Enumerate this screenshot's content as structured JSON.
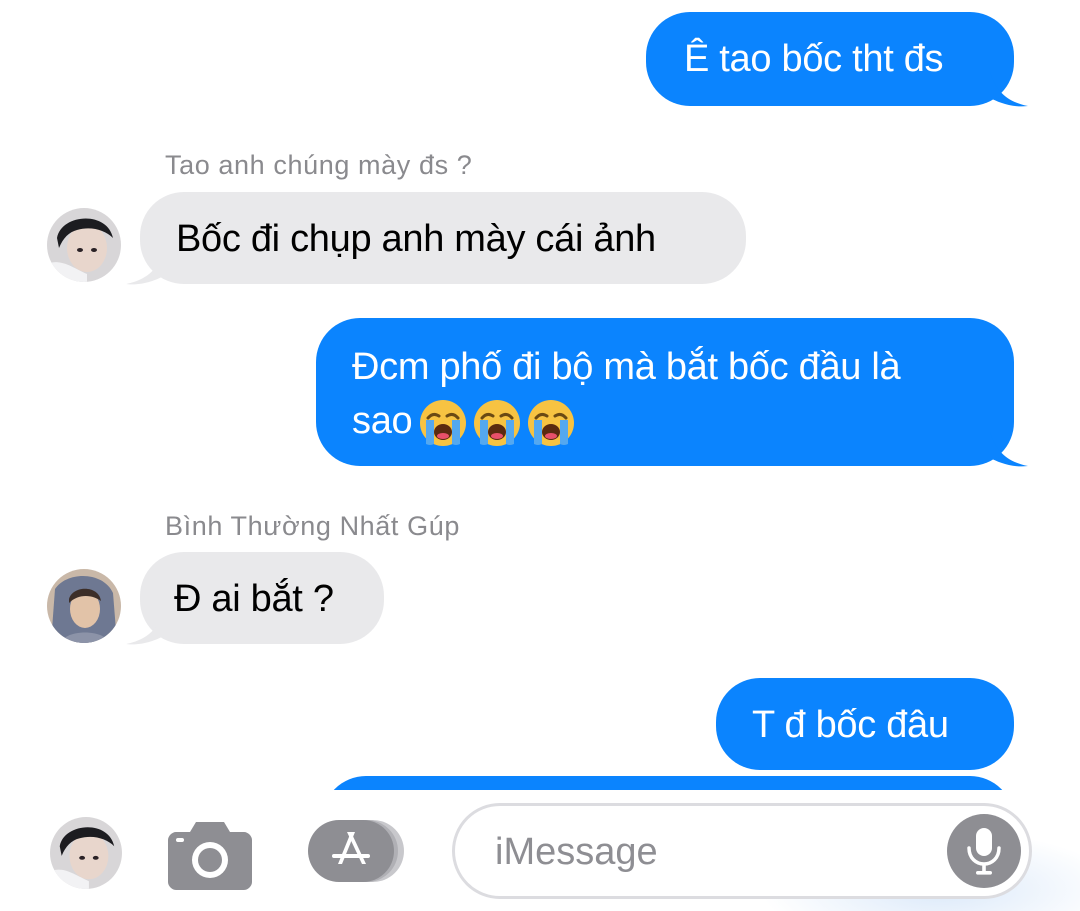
{
  "messages": [
    {
      "direction": "outgoing",
      "text": "Ê tao bốc tht đs"
    },
    {
      "direction": "incoming",
      "sender": "Tao anh chúng mày đs ?",
      "text": "Bốc đi chụp anh mày cái ảnh"
    },
    {
      "direction": "outgoing",
      "line1": "Đcm phố đi bộ mà bắt bốc đầu là",
      "line2": "sao",
      "emoji": "loudly-crying-face",
      "emoji_count": 3
    },
    {
      "direction": "incoming",
      "sender": "Bình Thường Nhất Gúp",
      "text": "Đ ai bắt ?"
    },
    {
      "direction": "outgoing",
      "text": "T đ bốc đâu"
    },
    {
      "direction": "outgoing",
      "text": ""
    }
  ],
  "composer": {
    "placeholder": "iMessage",
    "icons": {
      "avatar": "memoji-avatar",
      "camera": "camera-icon",
      "apps": "app-store-icon",
      "mic": "microphone-icon"
    }
  },
  "colors": {
    "outgoing_bubble": "#0b84fe",
    "incoming_bubble": "#e9e9eb",
    "sender_text": "#8a8a8e",
    "icon_gray": "#8e8e93"
  }
}
